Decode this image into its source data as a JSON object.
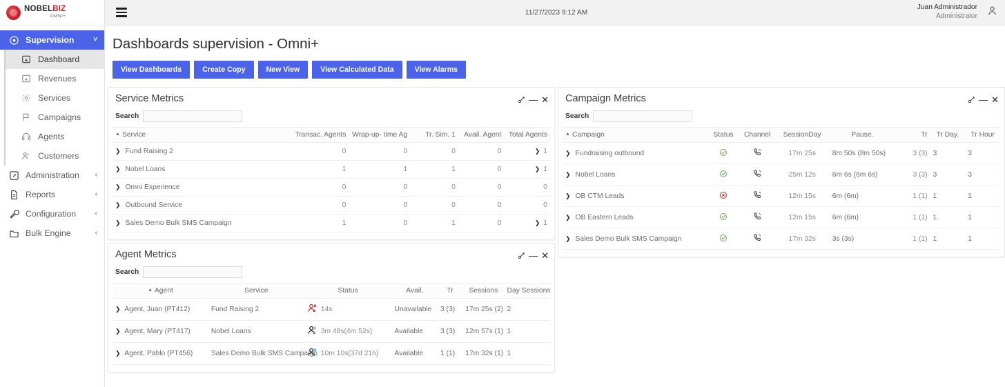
{
  "brand": {
    "name_part1": "NOBEL",
    "name_part2": "BIZ",
    "tagline": "OMNI+",
    "accent": "#cf2230",
    "primary": "#4b63e8"
  },
  "topbar": {
    "menu_icon": "hamburger-icon",
    "datetime": "11/27/2023 9:12 AM",
    "user_name": "Juan Administrador",
    "user_role": "Administrator",
    "avatar_icon": "user-icon"
  },
  "sidebar": {
    "items": [
      {
        "label": "Supervision",
        "icon": "eye-icon",
        "state": "active",
        "chevron": "˅"
      },
      {
        "label": "Dashboard",
        "icon": "dashboard-icon",
        "state": "selected"
      },
      {
        "label": "Revenues",
        "icon": "revenues-icon",
        "state": "normal"
      },
      {
        "label": "Services",
        "icon": "gear-icon",
        "state": "normal"
      },
      {
        "label": "Campaigns",
        "icon": "flag-icon",
        "state": "normal"
      },
      {
        "label": "Agents",
        "icon": "headset-icon",
        "state": "normal"
      },
      {
        "label": "Customers",
        "icon": "customers-icon",
        "state": "normal"
      },
      {
        "label": "Administration",
        "icon": "edit-square-icon",
        "state": "normal",
        "chevron": "‹"
      },
      {
        "label": "Reports",
        "icon": "document-icon",
        "state": "normal",
        "chevron": "‹"
      },
      {
        "label": "Configuration",
        "icon": "wrench-icon",
        "state": "normal",
        "chevron": "‹"
      },
      {
        "label": "Bulk Engine",
        "icon": "folder-icon",
        "state": "normal",
        "chevron": "‹"
      }
    ]
  },
  "page": {
    "title": "Dashboards supervision - Omni+",
    "buttons": [
      "View Dashboards",
      "Create Copy",
      "New View",
      "View Calculated Data",
      "View Alarms"
    ]
  },
  "panels": {
    "service_metrics": {
      "title": "Service Metrics",
      "search_label": "Search",
      "search_value": "",
      "search_placeholder": "",
      "tools": [
        "link-icon",
        "minimize-icon",
        "close-icon"
      ],
      "columns": [
        "Service",
        "Transac. Agents",
        "Wrap-up- time Ag",
        "Tr. Sim. 1",
        "Avail. Agent",
        "Total Agents"
      ],
      "rows": [
        {
          "service": "Fund Raising 2",
          "transac_agents": "0",
          "wrapup_time": "0",
          "tr_sim": "0",
          "avail_agent": "0",
          "total_agents": "1",
          "total_expandable": true
        },
        {
          "service": "Nobel Loans",
          "transac_agents": "1",
          "wrapup_time": "1",
          "tr_sim": "1",
          "avail_agent": "0",
          "total_agents": "1",
          "total_expandable": true
        },
        {
          "service": "Omni Experience",
          "transac_agents": "0",
          "wrapup_time": "0",
          "tr_sim": "0",
          "avail_agent": "0",
          "total_agents": "0",
          "total_expandable": false
        },
        {
          "service": "Outbound Service",
          "transac_agents": "0",
          "wrapup_time": "0",
          "tr_sim": "0",
          "avail_agent": "0",
          "total_agents": "0",
          "total_expandable": false
        },
        {
          "service": "Sales Demo Bulk SMS Campaign",
          "transac_agents": "1",
          "wrapup_time": "0",
          "tr_sim": "1",
          "avail_agent": "0",
          "total_agents": "1",
          "total_expandable": true
        }
      ]
    },
    "campaign_metrics": {
      "title": "Campaign Metrics",
      "search_label": "Search",
      "search_value": "",
      "search_placeholder": "",
      "tools": [
        "link-icon",
        "minimize-icon",
        "close-icon"
      ],
      "columns": [
        "Campaign",
        "Status",
        "Channel",
        "SessionDay",
        "Pause.",
        "Tr",
        "Tr Day.",
        "Tr Hour"
      ],
      "rows": [
        {
          "campaign": "Fundraising outbound",
          "status": "ok",
          "channel": "phone-icon",
          "session_day": "17m 25s",
          "pause": "8m 50s (8m 50s)",
          "tr": "3 (3)",
          "tr_day": "3",
          "tr_hour": "3"
        },
        {
          "campaign": "Nobel Loans",
          "status": "ok",
          "channel": "phone-icon",
          "session_day": "25m 12s",
          "pause": "6m 6s (6m 6s)",
          "tr": "3 (3)",
          "tr_day": "3",
          "tr_hour": "3"
        },
        {
          "campaign": "OB CTM Leads",
          "status": "error",
          "channel": "phone-icon",
          "session_day": "12m 15s",
          "pause": "6m (6m)",
          "tr": "1 (1)",
          "tr_day": "1",
          "tr_hour": "1"
        },
        {
          "campaign": "OB Eastern Leads",
          "status": "ok",
          "channel": "phone-icon",
          "session_day": "12m 15s",
          "pause": "6m (6m)",
          "tr": "1 (1)",
          "tr_day": "1",
          "tr_hour": "1"
        },
        {
          "campaign": "Sales Demo Bulk SMS Campaign",
          "status": "ok",
          "channel": "phone-icon",
          "session_day": "17m 32s",
          "pause": "3s (3s)",
          "tr": "1 (1)",
          "tr_day": "1",
          "tr_hour": "1"
        }
      ],
      "status_colors": {
        "ok": "#6aa84f",
        "error": "#cc2222"
      }
    },
    "agent_metrics": {
      "title": "Agent Metrics",
      "search_label": "Search",
      "search_value": "",
      "search_placeholder": "",
      "tools": [
        "link-icon",
        "minimize-icon",
        "close-icon"
      ],
      "columns": [
        "Agent",
        "Service",
        "Status",
        "Avail.",
        "Tr",
        "Sessions",
        "Day Sessions"
      ],
      "rows": [
        {
          "agent": "Agent, Juan (PT412)",
          "service": "Fund Raising 2",
          "status_icon": "agent-unavailable-icon",
          "status_time": "14s",
          "avail": "Unavailable",
          "tr": "3 (3)",
          "sessions": "17m 25s (2)",
          "day_sessions": "2"
        },
        {
          "agent": "Agent, Mary (PT417)",
          "service": "Nobel Loans",
          "status_icon": "agent-available-icon",
          "status_time": "3m 48s(4m 52s)",
          "avail": "Available",
          "tr": "3 (3)",
          "sessions": "12m 57s (1)",
          "day_sessions": "1"
        },
        {
          "agent": "Agent, Pablo (PT456)",
          "service": "Sales Demo Bulk SMS Campaign",
          "status_icon": "agent-available-icon",
          "status_time": "10m 10s(37d 21h)",
          "avail": "Available",
          "tr": "1 (1)",
          "sessions": "17m 32s (1)",
          "day_sessions": "1"
        }
      ]
    }
  }
}
